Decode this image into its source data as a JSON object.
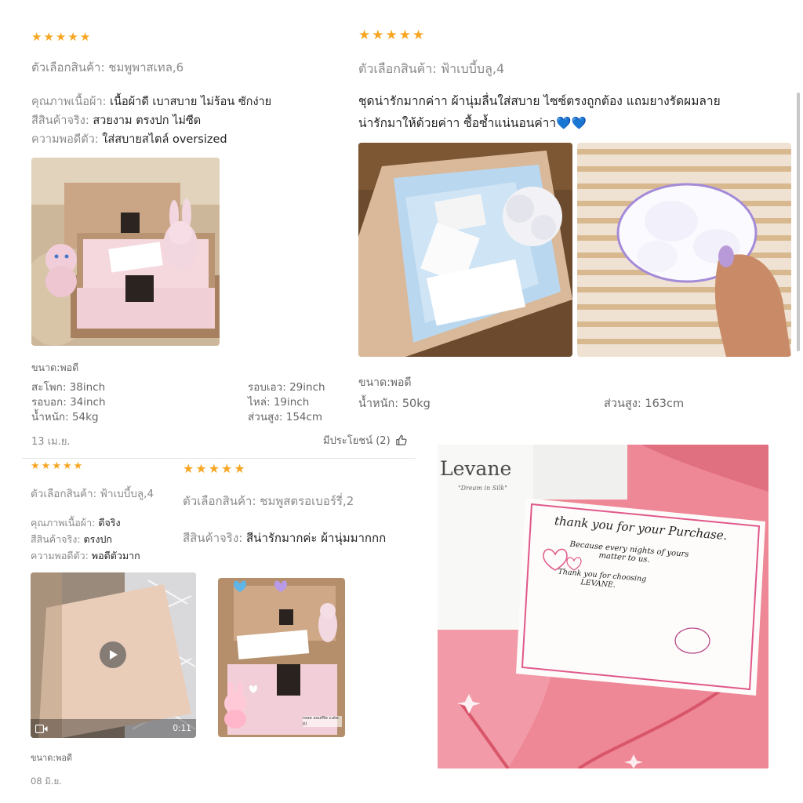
{
  "review1": {
    "stars": [
      "★",
      "★",
      "★",
      "★",
      "★"
    ],
    "variant": "ตัวเลือกสินค้า: ชมพูพาสเทล,6",
    "lines": [
      {
        "label": "คุณภาพเนื้อผ้า:",
        "value": "เนื้อผ้าดี เบาสบาย ไม่ร้อน ซักง่าย"
      },
      {
        "label": "สีสินค้าจริง:",
        "value": "สวยงาม ตรงปก ไม่ซีด"
      },
      {
        "label": "ความพอดีตัว:",
        "value": "ใส่สบายสไตล์ oversized"
      }
    ],
    "size_title": "ขนาด:พอดี",
    "measures": [
      {
        "label": "สะโพก:",
        "value": "38inch"
      },
      {
        "label": "รอบเอว:",
        "value": "29inch"
      },
      {
        "label": "รอบอก:",
        "value": "34inch"
      },
      {
        "label": "ไหล่:",
        "value": "19inch"
      },
      {
        "label": "น้ำหนัก:",
        "value": "54kg"
      },
      {
        "label": "ส่วนสูง:",
        "value": "154cm"
      }
    ],
    "date": "13 เม.ย.",
    "helpful": "มีประโยชน์ (2)"
  },
  "review2": {
    "stars": [
      "★",
      "★",
      "★",
      "★",
      "★"
    ],
    "variant": "ตัวเลือกสินค้า: ฟ้าเบบี้บลู,4",
    "comment_1": "ชุดน่ารักมากค่าา ผ้านุ่มลื่นใส่สบาย ไซซ์ตรงถูกต้อง แถมยางรัดผมลาย",
    "comment_2": "น่ารักมาให้ด้วยค่าา ซื้อซ้ำแน่นอนค่าา💙💙",
    "size_title": "ขนาด:พอดี",
    "measures": [
      {
        "label": "น้ำหนัก:",
        "value": "50kg"
      },
      {
        "label": "ส่วนสูง:",
        "value": "163cm"
      }
    ]
  },
  "review3": {
    "stars": [
      "★",
      "★",
      "★",
      "★",
      "★"
    ],
    "variant": "ตัวเลือกสินค้า: ฟ้าเบบี้บลู,4",
    "lines": [
      {
        "label": "คุณภาพเนื้อผ้า:",
        "value": "ดีจริง"
      },
      {
        "label": "สีสินค้าจริง:",
        "value": "ตรงปก"
      },
      {
        "label": "ความพอดีตัว:",
        "value": "พอดีตัวมาก"
      }
    ],
    "video_duration": "0:11",
    "size_title": "ขนาด:พอดี",
    "date": "08 มิ.ย."
  },
  "review4": {
    "stars": [
      "★",
      "★",
      "★",
      "★",
      "★"
    ],
    "variant": "ตัวเลือกสินค้า: ชมพูสตรอเบอร์รี่,2",
    "line": {
      "label": "สีสินค้าจริง:",
      "value": "สีน่ารักมากค่ะ ผ้านุ่มมากกก"
    }
  },
  "photo_text": {
    "brand": "Levane",
    "brand_tagline": "\"Dream in Silk\"",
    "card_line_1": "thank you for your Purchase.",
    "card_line_2": "Because every nights of yours",
    "card_line_3": "matter to us.",
    "card_line_4": "Thank you for choosing",
    "card_line_5": "LEVANE.",
    "sticker_text": "rose souffle cute pj"
  },
  "colors": {
    "star": "#f6a623",
    "pink_fabric": "#f08a9a",
    "box_tan": "#c9a98a"
  }
}
